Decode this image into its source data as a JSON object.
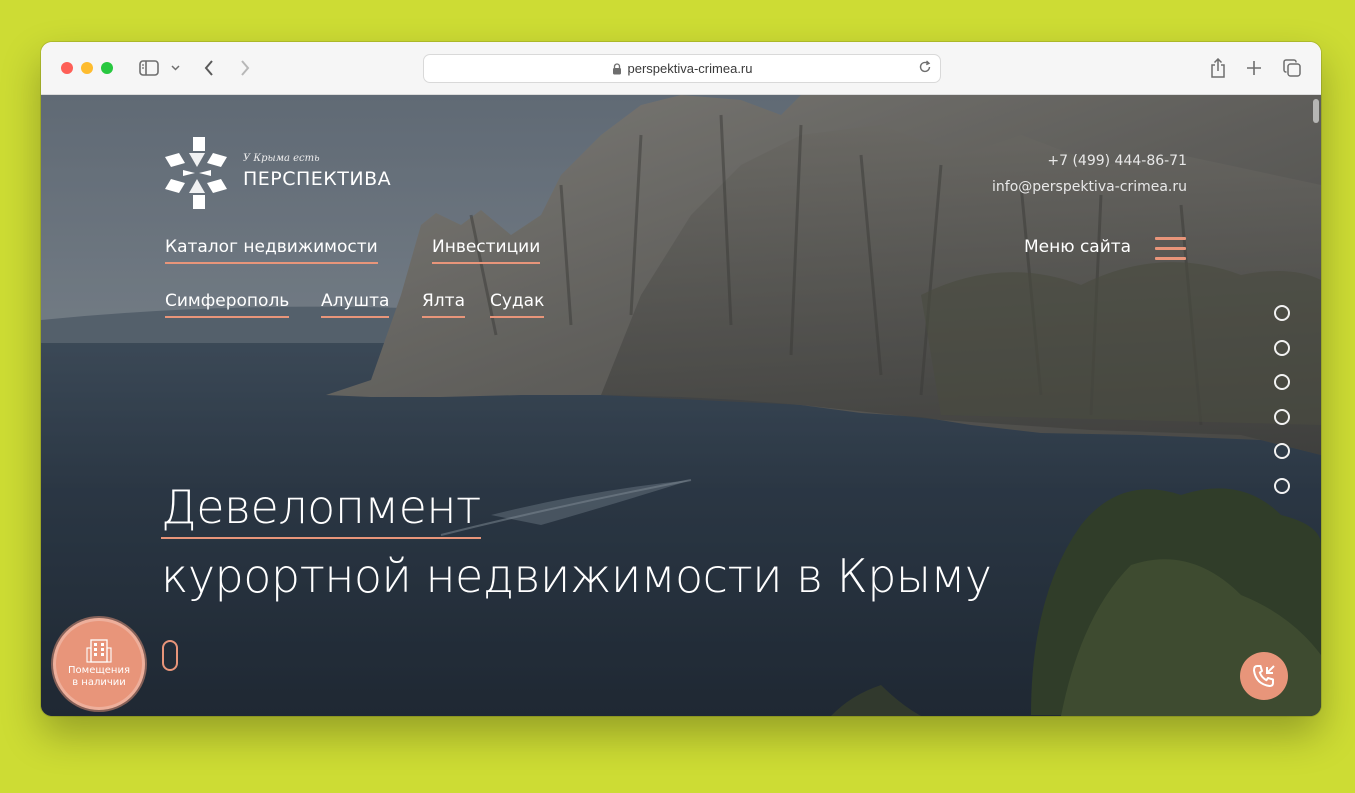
{
  "browser": {
    "url": "perspektiva-crimea.ru"
  },
  "site": {
    "logo": {
      "tagline": "У Крыма есть",
      "name": "ПЕРСПЕКТИВА"
    },
    "contacts": {
      "phone": "+7 (499) 444-86-71",
      "email": "info@perspektiva-crimea.ru"
    },
    "nav_primary": [
      "Каталог недвижимости",
      "Инвестиции"
    ],
    "nav_cities": [
      "Симферополь",
      "Алушта",
      "Ялта",
      "Судак"
    ],
    "menu_label": "Меню сайта",
    "hero": {
      "line1": "Девелопмент",
      "line2": "курортной недвижимости в Крыму"
    },
    "available_button": "Помещения в наличии",
    "slider_dots_count": 6,
    "colors": {
      "accent": "#e8957a",
      "background": "#cddc34"
    }
  }
}
